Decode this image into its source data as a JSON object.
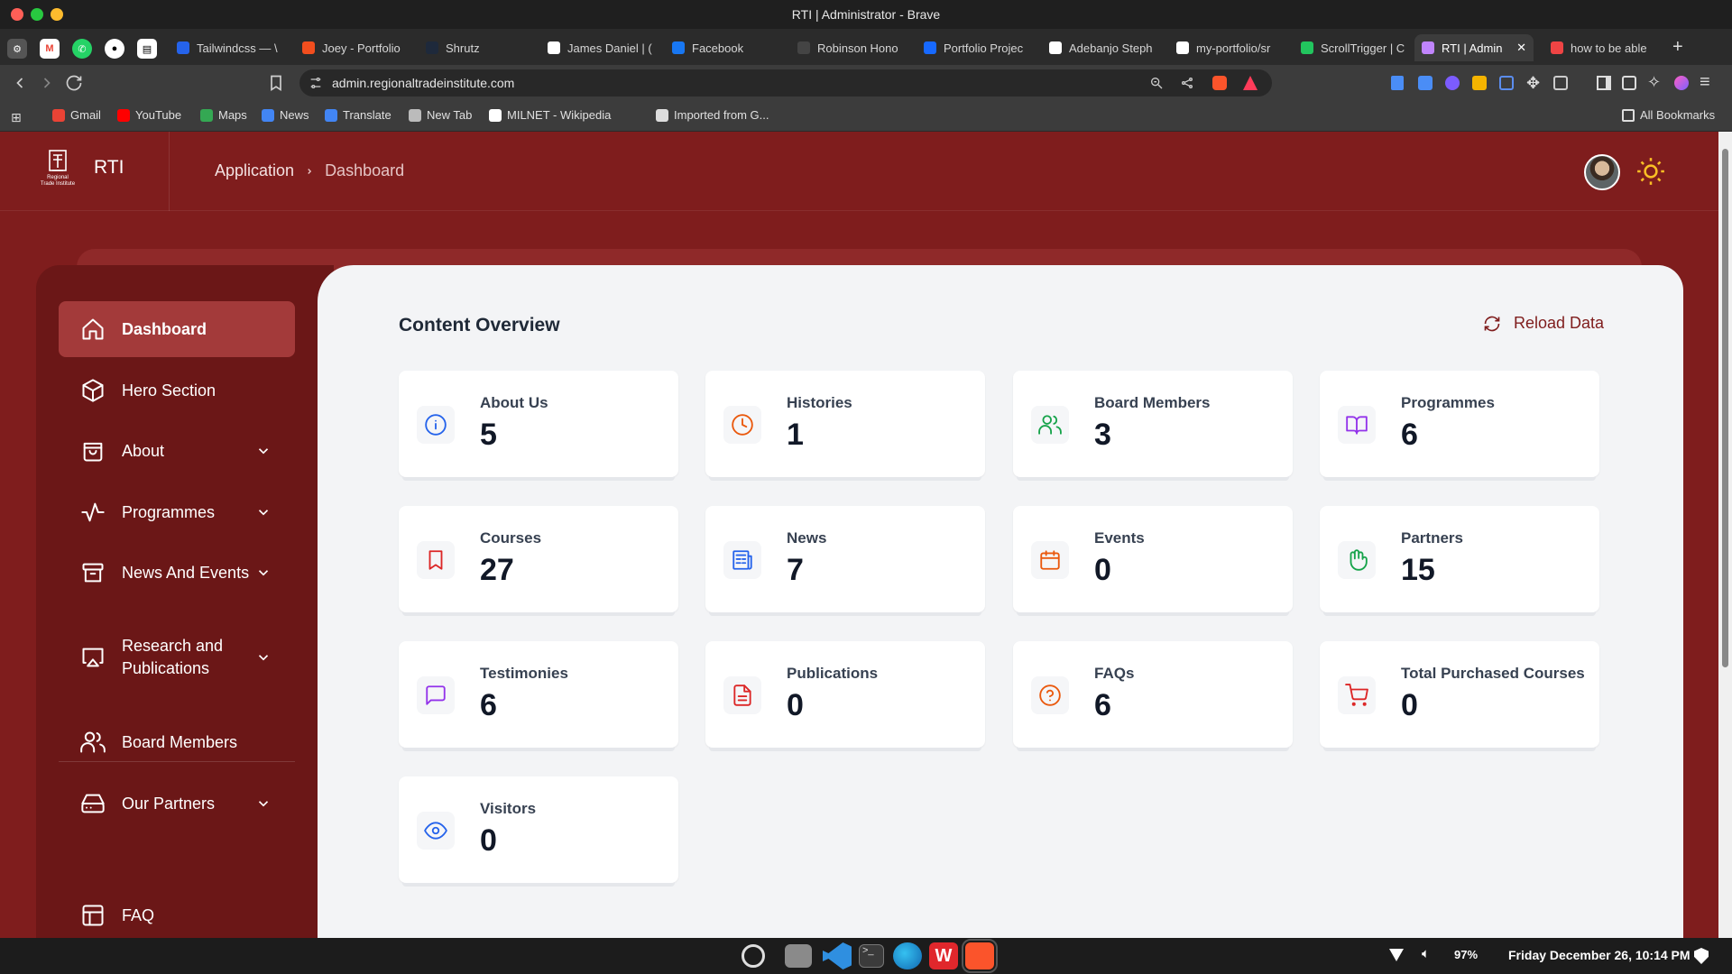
{
  "window": {
    "title": "RTI | Administrator - Brave"
  },
  "tabs": [
    {
      "label": "Tailwindcss — \\",
      "color": "#2563eb"
    },
    {
      "label": "Joey - Portfolio",
      "color": "#f24e1e"
    },
    {
      "label": "Shrutz",
      "color": "#1e293b"
    },
    {
      "label": "James Daniel | (",
      "color": "#ffffff"
    },
    {
      "label": "Facebook",
      "color": "#1877f2"
    },
    {
      "label": "Robinson Hono",
      "color": "#444444"
    },
    {
      "label": "Portfolio Projec",
      "color": "#1769ff"
    },
    {
      "label": "Adebanjo Steph",
      "color": "#ffffff"
    },
    {
      "label": "my-portfolio/sr",
      "color": "#ffffff"
    },
    {
      "label": "ScrollTrigger | C",
      "color": "#22c55e"
    },
    {
      "label": "RTI | Admin",
      "color": "#c084fc"
    },
    {
      "label": "how to be able",
      "color": "#ef4444"
    }
  ],
  "addressbar": {
    "url": "admin.regionaltradeinstitute.com"
  },
  "bookmarks": [
    {
      "label": "Gmail",
      "color": "#ea4335"
    },
    {
      "label": "YouTube",
      "color": "#ff0000"
    },
    {
      "label": "Maps",
      "color": "#34a853"
    },
    {
      "label": "News",
      "color": "#4285f4"
    },
    {
      "label": "Translate",
      "color": "#4285f4"
    },
    {
      "label": "New Tab",
      "color": "#bbbbbb"
    },
    {
      "label": "MILNET - Wikipedia",
      "color": "#ffffff"
    },
    {
      "label": "Imported from G...",
      "color": "#dddddd"
    }
  ],
  "all_bookmarks": "All Bookmarks",
  "app": {
    "brand": "RTI",
    "logo_text_1": "Regional",
    "logo_text_2": "Trade Institute",
    "breadcrumb": [
      "Application",
      "Dashboard"
    ]
  },
  "sidebar": {
    "items": [
      {
        "label": "Dashboard",
        "icon": "home-icon",
        "active": true
      },
      {
        "label": "Hero Section",
        "icon": "cube-icon"
      },
      {
        "label": "About",
        "icon": "shopping-bag-icon",
        "dropdown": true
      },
      {
        "label": "Programmes",
        "icon": "activity-icon",
        "dropdown": true
      },
      {
        "label": "News And Events",
        "icon": "archive-icon",
        "dropdown": true
      },
      {
        "label": "Research and Publications",
        "icon": "airplay-icon",
        "dropdown": true
      },
      {
        "label": "Board Members",
        "icon": "users-icon"
      },
      {
        "label": "Our Partners",
        "icon": "hard-drive-icon",
        "dropdown": true
      },
      {
        "label": "FAQ",
        "icon": "table-icon"
      }
    ]
  },
  "overview": {
    "title": "Content Overview",
    "reload_label": "Reload Data",
    "cards": [
      {
        "label": "About Us",
        "value": "5",
        "icon": "info-icon",
        "color": "#2563eb"
      },
      {
        "label": "Histories",
        "value": "1",
        "icon": "clock-icon",
        "color": "#ea580c"
      },
      {
        "label": "Board Members",
        "value": "3",
        "icon": "users-icon",
        "color": "#16a34a"
      },
      {
        "label": "Programmes",
        "value": "6",
        "icon": "book-open-icon",
        "color": "#9333ea"
      },
      {
        "label": "Courses",
        "value": "27",
        "icon": "bookmark-icon",
        "color": "#dc2626"
      },
      {
        "label": "News",
        "value": "7",
        "icon": "newspaper-icon",
        "color": "#2563eb"
      },
      {
        "label": "Events",
        "value": "0",
        "icon": "calendar-icon",
        "color": "#ea580c"
      },
      {
        "label": "Partners",
        "value": "15",
        "icon": "hand-icon",
        "color": "#16a34a"
      },
      {
        "label": "Testimonies",
        "value": "6",
        "icon": "message-icon",
        "color": "#9333ea"
      },
      {
        "label": "Publications",
        "value": "0",
        "icon": "file-text-icon",
        "color": "#dc2626"
      },
      {
        "label": "FAQs",
        "value": "6",
        "icon": "help-circle-icon",
        "color": "#ea580c"
      },
      {
        "label": "Total Purchased Courses",
        "value": "0",
        "icon": "cart-icon",
        "color": "#dc2626"
      },
      {
        "label": "Visitors",
        "value": "0",
        "icon": "eye-icon",
        "color": "#2563eb"
      }
    ]
  },
  "system": {
    "battery": "97%",
    "clock": "Friday December 26, 10:14 PM"
  }
}
